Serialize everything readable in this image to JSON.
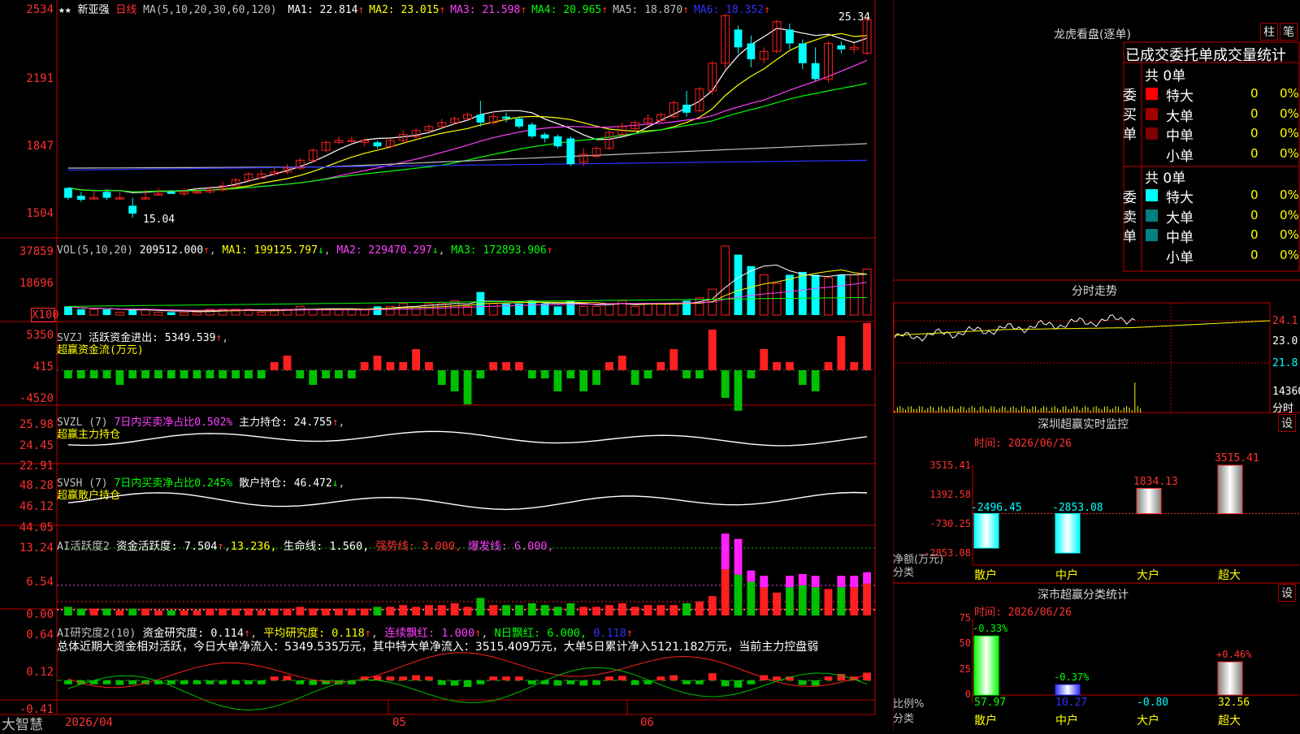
{
  "main": {
    "stock": "新亚强",
    "period": "日线",
    "ma_label": "MA(5,10,20,30,60,120)",
    "ma": [
      {
        "label": "MA1: 22.814",
        "arrow": "↑",
        "color": "#ffffff"
      },
      {
        "label": "MA2: 23.015",
        "arrow": "↑",
        "color": "#ffff00"
      },
      {
        "label": "MA3: 21.598",
        "arrow": "↑",
        "color": "#ff40ff"
      },
      {
        "label": "MA4: 20.965",
        "arrow": "↑",
        "color": "#00ff00"
      },
      {
        "label": "MA5: 18.870",
        "arrow": "↑",
        "color": "#c0c0c0"
      },
      {
        "label": "MA6: 18.352",
        "arrow": "↑",
        "color": "#3030ff"
      }
    ],
    "yticks": [
      "2534",
      "2191",
      "1847",
      "1504"
    ],
    "ylim": [
      15.04,
      25.34
    ],
    "high_label": "25.34",
    "low_label": "15.04",
    "dates": [
      "2026/04",
      "05",
      "06"
    ]
  },
  "vol": {
    "label": "VOL(5,10,20)",
    "value": "209512.000",
    "ma1": "MA1: 199125.797",
    "ma2": "MA2: 229470.297",
    "ma3": "MA3: 172893.906",
    "yticks": [
      "37859",
      "18696",
      "X100"
    ]
  },
  "svzj": {
    "label": "SVZJ",
    "text": "活跃资金进出: 5349.539",
    "sub": "超赢资金流(万元)",
    "yticks": [
      "5350",
      "415",
      "-4520"
    ]
  },
  "svzl": {
    "label": "SVZL (7)",
    "ratio": "7日内买卖净占比0.502%",
    "hold": "主力持仓: 24.755",
    "sub": "超赢主力持仓",
    "yticks": [
      "25.98",
      "24.45",
      "22.91"
    ]
  },
  "svsh": {
    "label": "SVSH (7)",
    "ratio": "7日内买卖净占比0.245%",
    "hold": "散户持仓: 46.472",
    "sub": "超赢散户持仓",
    "yticks": [
      "48.28",
      "46.12",
      "44.05"
    ]
  },
  "ai1": {
    "label": "AI活跃度2",
    "value": "资金活跃度: 7.504",
    "v2": "13.236,",
    "life": "生命线: 1.560,",
    "strong": "强势线: 3.000,",
    "burst": "爆发线: 6.000,",
    "yticks": [
      "13.24",
      "6.54",
      "0.00"
    ]
  },
  "ai2": {
    "label": "AI研究度2(10)",
    "value": "资金研究度: 0.114",
    "avg": "平均研究度: 0.118",
    "lianxu": "连续飘红: 1.000",
    "nday": "N日飘红: 6.000,",
    "last": "0.118",
    "summary": "总体近期大资金相对活跃，今日大单净流入：5349.535万元，其中特大单净流入：3515.409万元，大单5日累计净入5121.182万元，当前主力控盘弱",
    "yticks": [
      "0.64",
      "0.12",
      "-0.41"
    ]
  },
  "brand": "大智慧",
  "right": {
    "lhb_title": "龙虎看盘(逐单)",
    "btn_zhu": "柱",
    "btn_bi": "笔",
    "lhb_header": "已成交委托单成交量统计",
    "buy_label": "委买单",
    "sell_label": "委卖单",
    "buy_total": "共 0单",
    "sell_total": "共 0单",
    "buy_rows": [
      {
        "name": "特大",
        "val": "0",
        "pct": "0%",
        "color": "#ff0000"
      },
      {
        "name": "大单",
        "val": "0",
        "pct": "0%",
        "color": "#a00000"
      },
      {
        "name": "中单",
        "val": "0",
        "pct": "0%",
        "color": "#800000"
      },
      {
        "name": "小单",
        "val": "0",
        "pct": "0%",
        "color": ""
      }
    ],
    "sell_rows": [
      {
        "name": "特大",
        "val": "0",
        "pct": "0%",
        "color": "#00ffff"
      },
      {
        "name": "大单",
        "val": "0",
        "pct": "0%",
        "color": "#008080"
      },
      {
        "name": "中单",
        "val": "0",
        "pct": "0%",
        "color": "#008080"
      },
      {
        "name": "小单",
        "val": "0",
        "pct": "0%",
        "color": ""
      }
    ],
    "fs_title": "分时走势",
    "fs_ticks": [
      "24.1",
      "23.0",
      "21.8",
      "14360",
      "分时"
    ],
    "sz_title": "深圳超赢实时监控",
    "sz_set": "设",
    "sz_time": "时间: 2026/06/26",
    "sz_yticks": [
      "3515.41",
      "1392.58",
      "-730.25",
      "-2853.08"
    ],
    "sz_ylabel": "净额(万元)",
    "sz_xlabel": "分类",
    "sz_cats": [
      "散户",
      "中户",
      "大户",
      "超大"
    ],
    "sz_values": [
      "-2496.45",
      "-2853.08",
      "1834.13",
      "3515.41"
    ],
    "ss_title": "深市超赢分类统计",
    "ss_set": "设",
    "ss_time": "时间: 2026/06/26",
    "ss_yticks": [
      "75",
      "50",
      "25",
      "0"
    ],
    "ss_ylabel": "比例%",
    "ss_xlabel": "分类",
    "ss_cats": [
      "散户",
      "中户",
      "大户",
      "超大"
    ],
    "ss_pct": [
      "-0.33%",
      "-0.37%",
      "",
      "+0.46%"
    ],
    "ss_vals": [
      "57.97",
      "10.27",
      "-0.80",
      "32.56"
    ]
  },
  "chart_data": {
    "type": "candlestick",
    "title": "新亚强 日线",
    "candles": [
      [
        16.5,
        16.5,
        16.0,
        15.9
      ],
      [
        16.1,
        16.3,
        15.9,
        15.8
      ],
      [
        16.0,
        16.3,
        16.0,
        15.9
      ],
      [
        16.3,
        16.4,
        16.0,
        15.9
      ],
      [
        16.0,
        16.3,
        16.0,
        15.9
      ],
      [
        15.6,
        16.0,
        15.2,
        15.0
      ],
      [
        16.0,
        16.4,
        16.0,
        15.9
      ],
      [
        16.2,
        16.5,
        16.2,
        16.1
      ],
      [
        16.3,
        16.4,
        16.2,
        16.2
      ],
      [
        16.2,
        16.5,
        16.3,
        16.1
      ],
      [
        16.3,
        16.5,
        16.3,
        16.2
      ],
      [
        16.3,
        16.6,
        16.4,
        16.2
      ],
      [
        16.4,
        16.8,
        16.6,
        16.3
      ],
      [
        16.6,
        17.0,
        16.9,
        16.5
      ],
      [
        16.9,
        17.3,
        17.2,
        16.8
      ],
      [
        17.0,
        17.4,
        17.2,
        17.0
      ],
      [
        17.2,
        17.5,
        17.3,
        17.1
      ],
      [
        17.3,
        17.7,
        17.5,
        17.2
      ],
      [
        17.5,
        18.0,
        17.9,
        17.4
      ],
      [
        17.9,
        18.5,
        18.4,
        17.8
      ],
      [
        18.4,
        18.9,
        18.8,
        18.3
      ],
      [
        18.8,
        19.1,
        18.9,
        18.7
      ],
      [
        18.9,
        19.1,
        18.9,
        18.8
      ],
      [
        18.8,
        19.0,
        18.9,
        18.6
      ],
      [
        18.8,
        18.9,
        18.6,
        18.5
      ],
      [
        18.6,
        19.0,
        18.9,
        18.5
      ],
      [
        18.9,
        19.4,
        19.2,
        18.8
      ],
      [
        19.1,
        19.5,
        19.4,
        19.0
      ],
      [
        19.4,
        19.7,
        19.6,
        19.3
      ],
      [
        19.6,
        20.0,
        19.8,
        19.5
      ],
      [
        19.8,
        20.1,
        20.0,
        19.7
      ],
      [
        20.0,
        20.3,
        20.2,
        19.9
      ],
      [
        20.2,
        20.9,
        19.8,
        19.6
      ],
      [
        19.8,
        20.4,
        20.1,
        19.7
      ],
      [
        20.1,
        20.3,
        20.0,
        19.8
      ],
      [
        20.0,
        20.1,
        19.6,
        19.5
      ],
      [
        19.7,
        19.8,
        19.1,
        19.0
      ],
      [
        19.2,
        19.3,
        19.0,
        18.8
      ],
      [
        19.1,
        19.2,
        18.6,
        18.5
      ],
      [
        19.0,
        19.1,
        17.7,
        17.6
      ],
      [
        17.8,
        18.5,
        18.2,
        17.6
      ],
      [
        18.1,
        18.6,
        18.5,
        18.0
      ],
      [
        18.5,
        19.4,
        19.3,
        18.4
      ],
      [
        19.2,
        19.8,
        19.6,
        19.1
      ],
      [
        19.5,
        19.9,
        19.8,
        19.3
      ],
      [
        19.8,
        20.2,
        20.0,
        19.6
      ],
      [
        19.9,
        20.3,
        20.2,
        19.8
      ],
      [
        20.1,
        20.9,
        20.8,
        20.0
      ],
      [
        20.7,
        21.4,
        20.3,
        20.1
      ],
      [
        20.4,
        21.6,
        21.5,
        20.3
      ],
      [
        21.4,
        22.9,
        22.8,
        21.2
      ],
      [
        22.8,
        25.3,
        25.2,
        22.5
      ],
      [
        24.5,
        24.7,
        23.6,
        23.3
      ],
      [
        23.8,
        24.2,
        23.0,
        22.6
      ],
      [
        23.0,
        23.6,
        23.4,
        22.8
      ],
      [
        23.4,
        25.0,
        24.9,
        23.3
      ],
      [
        24.5,
        24.8,
        23.8,
        23.5
      ],
      [
        23.8,
        24.0,
        22.8,
        22.5
      ],
      [
        22.8,
        23.6,
        22.0,
        21.9
      ],
      [
        22.0,
        23.9,
        23.8,
        21.8
      ],
      [
        23.7,
        23.9,
        23.5,
        23.3
      ],
      [
        23.5,
        23.8,
        23.6,
        23.3
      ],
      [
        23.3,
        25.1,
        25.0,
        23.2
      ]
    ],
    "volume": [
      3,
      2,
      2,
      2,
      1,
      2,
      2,
      1,
      1,
      1,
      1,
      2,
      2,
      2,
      2,
      1,
      2,
      2,
      3,
      2,
      2,
      2,
      2,
      2,
      3,
      3,
      4,
      3,
      4,
      4,
      5,
      3,
      8,
      4,
      4,
      4,
      5,
      4,
      3,
      5,
      3,
      3,
      4,
      5,
      3,
      4,
      4,
      4,
      5,
      6,
      9,
      24,
      21,
      17,
      14,
      11,
      14,
      15,
      14,
      13,
      14,
      14,
      16
    ],
    "svzj": [
      -1,
      -1,
      -1,
      -1,
      -2,
      -1,
      -1,
      -1,
      -1,
      -1,
      -1,
      -1,
      -1,
      -1,
      -1,
      -1,
      1,
      2,
      -1,
      -2,
      -1,
      -1,
      -1,
      1,
      2,
      1,
      1,
      3,
      1,
      -2,
      -3,
      -5,
      -1,
      1,
      1,
      1,
      -1,
      -1,
      -3,
      -1,
      -3,
      -2,
      1,
      2,
      -2,
      -1,
      1,
      3,
      -1,
      -1,
      6,
      -4,
      -6,
      -1,
      3,
      1,
      1,
      -2,
      -3,
      1,
      5,
      1,
      7
    ]
  }
}
